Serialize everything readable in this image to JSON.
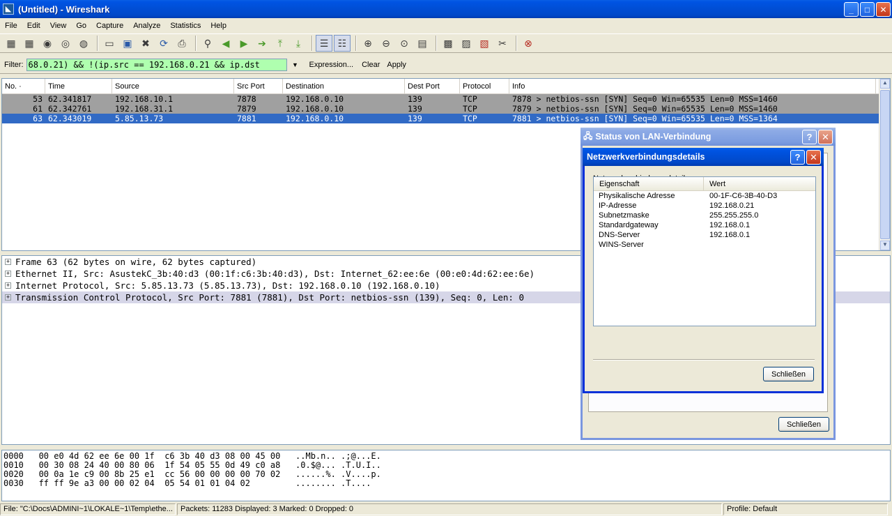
{
  "window": {
    "title": "(Untitled) - Wireshark",
    "min": "_",
    "max": "□",
    "close": "✕"
  },
  "menu": [
    "File",
    "Edit",
    "View",
    "Go",
    "Capture",
    "Analyze",
    "Statistics",
    "Help"
  ],
  "filter": {
    "label": "Filter:",
    "value": "68.0.21) && !(ip.src == 192.168.0.21 && ip.dst",
    "expression": "Expression...",
    "clear": "Clear",
    "apply": "Apply"
  },
  "packet_list": {
    "columns": [
      "No. ·",
      "Time",
      "Source",
      "Src Port",
      "Destination",
      "Dest Port",
      "Protocol",
      "Info"
    ],
    "rows": [
      {
        "no": "53",
        "time": "62.341817",
        "src": "192.168.10.1",
        "sport": "7878",
        "dst": "192.168.0.10",
        "dport": "139",
        "proto": "TCP",
        "info": "7878 > netbios-ssn [SYN] Seq=0 Win=65535 Len=0 MSS=1460"
      },
      {
        "no": "61",
        "time": "62.342761",
        "src": "192.168.31.1",
        "sport": "7879",
        "dst": "192.168.0.10",
        "dport": "139",
        "proto": "TCP",
        "info": "7879 > netbios-ssn [SYN] Seq=0 Win=65535 Len=0 MSS=1460"
      },
      {
        "no": "63",
        "time": "62.343019",
        "src": "5.85.13.73",
        "sport": "7881",
        "dst": "192.168.0.10",
        "dport": "139",
        "proto": "TCP",
        "info": "7881 > netbios-ssn [SYN] Seq=0 Win=65535 Len=0 MSS=1364"
      }
    ]
  },
  "details": [
    "Frame 63 (62 bytes on wire, 62 bytes captured)",
    "Ethernet II, Src: AsustekC_3b:40:d3 (00:1f:c6:3b:40:d3), Dst: Internet_62:ee:6e (00:e0:4d:62:ee:6e)",
    "Internet Protocol, Src: 5.85.13.73 (5.85.13.73), Dst: 192.168.0.10 (192.168.0.10)",
    "Transmission Control Protocol, Src Port: 7881 (7881), Dst Port: netbios-ssn (139), Seq: 0, Len: 0"
  ],
  "hex": [
    "0000   00 e0 4d 62 ee 6e 00 1f  c6 3b 40 d3 08 00 45 00   ..Mb.n.. .;@...E.",
    "0010   00 30 08 24 40 00 80 06  1f 54 05 55 0d 49 c0 a8   .0.$@... .T.U.I..",
    "0020   00 0a 1e c9 00 8b 25 e1  cc 56 00 00 00 00 70 02   ......%. .V....p.",
    "0030   ff ff 9e a3 00 00 02 04  05 54 01 01 04 02         ........ .T...."
  ],
  "status": {
    "file": "File: \"C:\\Docs\\ADMINI~1\\LOKALE~1\\Temp\\ethe...",
    "packets": "Packets: 11283 Displayed: 3 Marked: 0 Dropped: 0",
    "profile": "Profile: Default"
  },
  "dialog_status": {
    "title": "Status von LAN-Verbindung",
    "help": "?",
    "close": "✕",
    "button": "Schließen"
  },
  "dialog_details": {
    "title": "Netzwerkverbindungsdetails",
    "help": "?",
    "close": "✕",
    "label": "Netzwerkverbindungsdetails:",
    "columns": [
      "Eigenschaft",
      "Wert"
    ],
    "rows": [
      {
        "k": "Physikalische Adresse",
        "v": "00-1F-C6-3B-40-D3"
      },
      {
        "k": "IP-Adresse",
        "v": "192.168.0.21"
      },
      {
        "k": "Subnetzmaske",
        "v": "255.255.255.0"
      },
      {
        "k": "Standardgateway",
        "v": "192.168.0.1"
      },
      {
        "k": "DNS-Server",
        "v": "192.168.0.1"
      },
      {
        "k": "WINS-Server",
        "v": ""
      }
    ],
    "button": "Schließen"
  },
  "colors": {
    "filter_ok": "#afffaf",
    "selected_row": "#316ac5",
    "marked_row": "#a0a0a0",
    "xp_title": "#0054e3"
  }
}
